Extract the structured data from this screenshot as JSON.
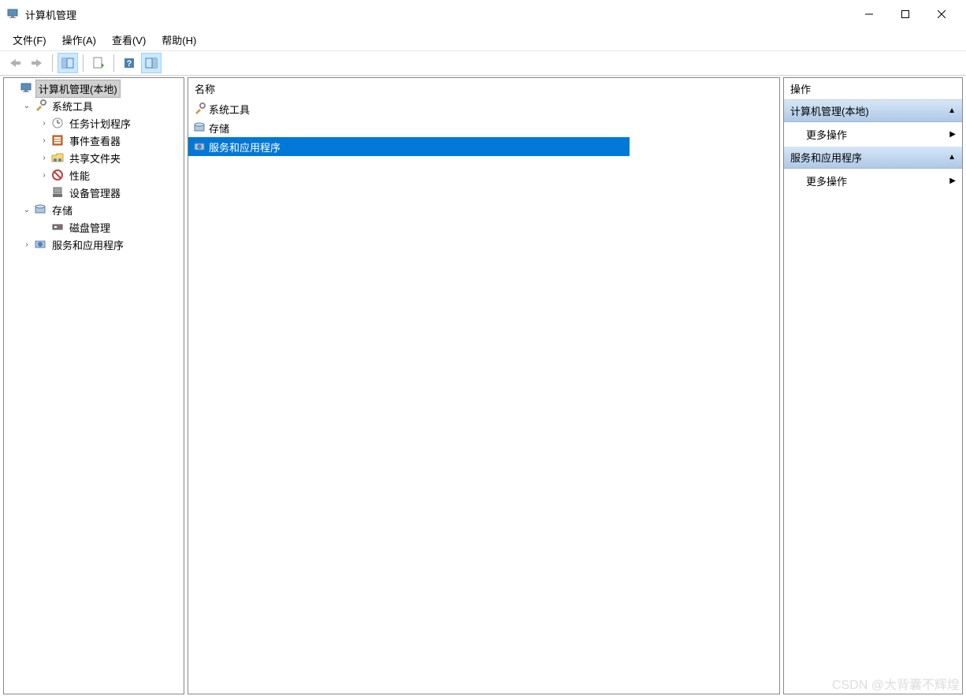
{
  "window": {
    "title": "计算机管理"
  },
  "menu": {
    "file": "文件(F)",
    "action": "操作(A)",
    "view": "查看(V)",
    "help": "帮助(H)"
  },
  "tree": {
    "root": "计算机管理(本地)",
    "systemTools": "系统工具",
    "taskScheduler": "任务计划程序",
    "eventViewer": "事件查看器",
    "sharedFolders": "共享文件夹",
    "performance": "性能",
    "deviceManager": "设备管理器",
    "storage": "存储",
    "diskManagement": "磁盘管理",
    "servicesApps": "服务和应用程序"
  },
  "list": {
    "header": "名称",
    "items": [
      "系统工具",
      "存储",
      "服务和应用程序"
    ]
  },
  "actions": {
    "header": "操作",
    "section1": "计算机管理(本地)",
    "more1": "更多操作",
    "section2": "服务和应用程序",
    "more2": "更多操作"
  },
  "watermark": "CSDN @大背囊不辉煌"
}
